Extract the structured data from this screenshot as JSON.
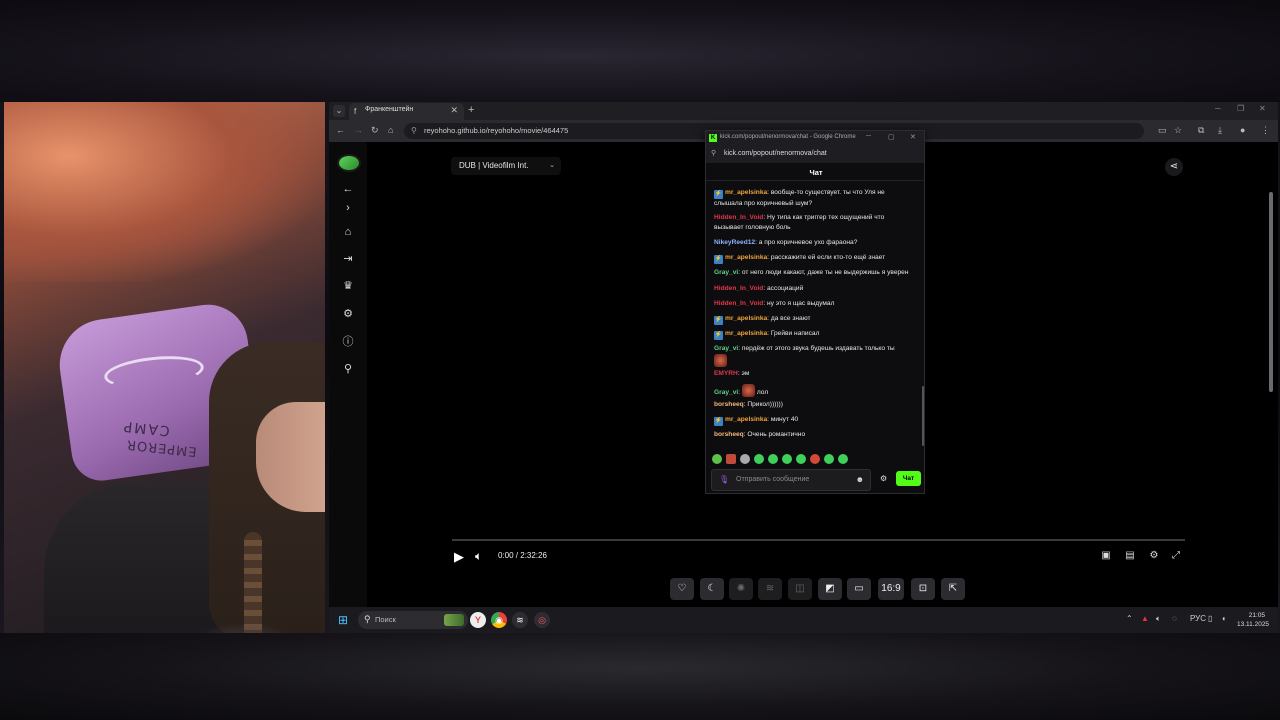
{
  "browser": {
    "tab_title": "Франкенштейн",
    "tab_favicon": "f",
    "url": "reyohoho.github.io/reyohoho/movie/464475"
  },
  "player": {
    "dub_label": "DUB | Videofilm Int.",
    "time": "0:00 / 2:32:26",
    "progress_fraction": 0.0,
    "aspect_label": "16:9"
  },
  "chat_popup": {
    "window_title": "kick.com/popout/nenormova/chat - Google Chrome",
    "url": "kick.com/popout/nenormova/chat",
    "header": "Чат",
    "input_placeholder": "Отправить сообщение",
    "send_label": "Чат",
    "messages": [
      {
        "user": "mr_apelsinka",
        "color": "#f0a33a",
        "badge": true,
        "text": ": вообще-то существует. ты что Уля не",
        "text2": "слышала про коричневый шум?"
      },
      {
        "user": "Hidden_In_Void",
        "color": "#e0374b",
        "badge": false,
        "text": ": Ну типа как триггер тех ощущений что",
        "text2": "вызывает головную боль"
      },
      {
        "user": "NikeyReed12",
        "color": "#8cb4ff",
        "badge": false,
        "text": ": а про коричневое ухо фараона?",
        "text2": ""
      },
      {
        "user": "mr_apelsinka",
        "color": "#f0a33a",
        "badge": true,
        "text": ": расскажите ей если кто-то ещё знает",
        "text2": ""
      },
      {
        "user": "Gray_vi",
        "color": "#5fd38a",
        "badge": false,
        "text": ": от него люди какают, даже ты не выдержишь я уверен",
        "text2": ""
      },
      {
        "user": "Hidden_In_Void",
        "color": "#e0374b",
        "badge": false,
        "text": ": ассоциаций",
        "text2": ""
      },
      {
        "user": "Hidden_In_Void",
        "color": "#e0374b",
        "badge": false,
        "text": ": ну это я щас выдумал",
        "text2": ""
      },
      {
        "user": "mr_apelsinka",
        "color": "#f0a33a",
        "badge": true,
        "text": ": да все знают",
        "text2": ""
      },
      {
        "user": "mr_apelsinka",
        "color": "#f0a33a",
        "badge": true,
        "text": ": Грейви написал",
        "text2": ""
      },
      {
        "user": "Gray_vi",
        "color": "#5fd38a",
        "badge": false,
        "text": ": пердёж от этого звука будешь издавать только ты",
        "text2": ""
      },
      {
        "user": "EMYRH",
        "color": "#e0374b",
        "badge": false,
        "text": ": эм",
        "text2": ""
      },
      {
        "user": "Gray_vi",
        "color": "#5fd38a",
        "badge": false,
        "text": ": лол",
        "text2": ""
      },
      {
        "user": "borsheeq",
        "color": "#f5b77a",
        "badge": false,
        "text": ": Прикол))))))",
        "text2": ""
      },
      {
        "user": "mr_apelsinka",
        "color": "#f0a33a",
        "badge": true,
        "text": ": минут 40",
        "text2": ""
      },
      {
        "user": "borsheeq",
        "color": "#f5b77a",
        "badge": false,
        "text": ": Очень романтично",
        "text2": ""
      }
    ]
  },
  "taskbar": {
    "search_placeholder": "Поиск",
    "lang": "РУС",
    "time": "21:05",
    "date": "13.11.2025"
  },
  "webcam": {
    "chair_text_1": "CAMP",
    "chair_text_2": "EMPEROR"
  },
  "colors": {
    "kick_green": "#53fc18",
    "sub_badge": "#3b82c4"
  }
}
